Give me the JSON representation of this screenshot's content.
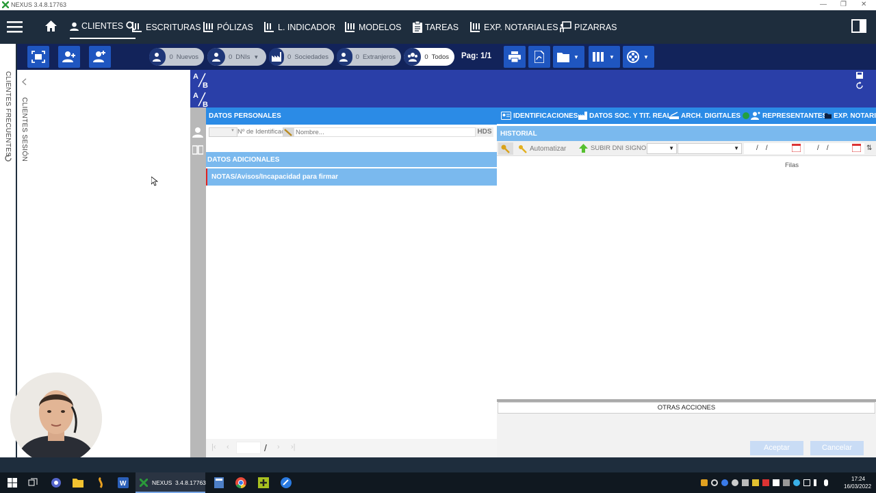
{
  "window": {
    "title": "NEXUS  3.4.8.17763",
    "controls": [
      "—",
      "❐",
      "✕"
    ]
  },
  "nav": {
    "items": [
      {
        "label": "CLIENTES",
        "icon": "person-icon"
      },
      {
        "label": "ESCRITURAS",
        "icon": "escrituras-icon"
      },
      {
        "label": "PÓLIZAS",
        "icon": "polizas-icon"
      },
      {
        "label": "L. INDICADOR",
        "icon": "indicador-icon"
      },
      {
        "label": "MODELOS",
        "icon": "modelos-icon"
      },
      {
        "label": "TAREAS",
        "icon": "clipboard-icon"
      },
      {
        "label": "EXP. NOTARIALES",
        "icon": "expedientes-icon"
      },
      {
        "label": "PIZARRAS",
        "icon": "whiteboard-icon"
      }
    ]
  },
  "filters": [
    {
      "count": "0",
      "label": "Nuevos"
    },
    {
      "count": "0",
      "label": "DNIs"
    },
    {
      "count": "0",
      "label": "Sociedades"
    },
    {
      "count": "0",
      "label": "Extranjeros"
    },
    {
      "count": "0",
      "label": "Todos"
    }
  ],
  "pagination": {
    "label": "Pag: 1/1"
  },
  "side": {
    "frequent": "CLIENTES FRECUENTES",
    "session": "CLIENTES SESIÓN"
  },
  "personal": {
    "header": "DATOS PERSONALES",
    "id_placeholder": "Nº de Identificación",
    "name_placeholder": "Nombre...",
    "hds": "HDS",
    "additional": "DATOS ADICIONALES",
    "notes": "NOTAS/Avisos/Incapacidad para firmar"
  },
  "tabs": [
    {
      "label": "IDENTIFICACIONES"
    },
    {
      "label": "DATOS SOC. Y TIT. REAL"
    },
    {
      "label": "ARCH. DIGITALES"
    },
    {
      "label": "REPRESENTANTES"
    },
    {
      "label": "EXP. NOTARI"
    }
  ],
  "historial": {
    "header": "HISTORIAL",
    "automatizar": "Automatizar",
    "subir": "SUBIR DNI SIGNO",
    "date1": "/    /",
    "date2": "/    /",
    "filas": "Filas"
  },
  "otras": {
    "label": "OTRAS ACCIONES"
  },
  "pager": {
    "slash": "/"
  },
  "actions": {
    "accept": "Aceptar",
    "cancel": "Cancelar"
  },
  "taskbar": {
    "app_label": "NEXUS  3.4.8.17763",
    "time": "17:24",
    "date": "16/03/2022"
  },
  "colors": {
    "nav_bg": "#1e2d3d",
    "toolbar_bg": "#12235a",
    "accent_blue": "#2b8be6",
    "header_blue": "#2a3fa8"
  }
}
